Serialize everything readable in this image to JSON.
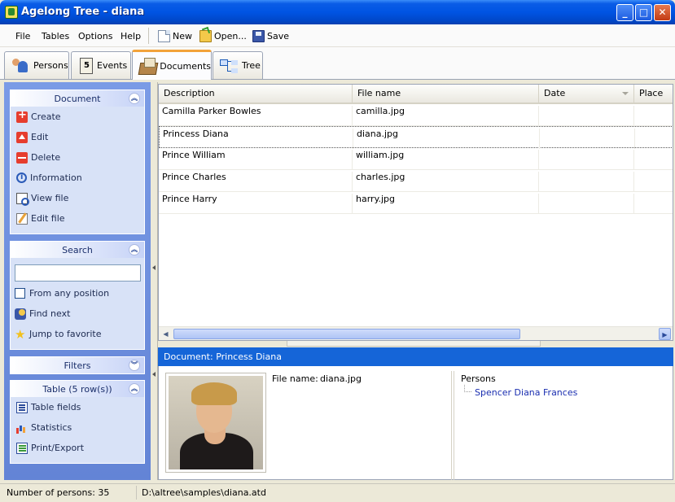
{
  "window": {
    "title": "Agelong Tree - diana"
  },
  "menu": [
    {
      "label": "File"
    },
    {
      "label": "Tables"
    },
    {
      "label": "Options"
    },
    {
      "label": "Help"
    }
  ],
  "toolbar": {
    "new_label": "New",
    "open_label": "Open...",
    "save_label": "Save"
  },
  "tabs": [
    {
      "label": "Persons",
      "icon": "persons-icon"
    },
    {
      "label": "Events",
      "icon": "calendar-icon"
    },
    {
      "label": "Documents",
      "icon": "documents-icon",
      "active": true
    },
    {
      "label": "Tree",
      "icon": "tree-icon"
    }
  ],
  "sidebar": {
    "document": {
      "title": "Document",
      "items": [
        {
          "label": "Create",
          "icon": "create-icon"
        },
        {
          "label": "Edit",
          "icon": "edit-icon"
        },
        {
          "label": "Delete",
          "icon": "delete-icon"
        },
        {
          "label": "Information",
          "icon": "information-icon"
        },
        {
          "label": "View file",
          "icon": "view-file-icon"
        },
        {
          "label": "Edit file",
          "icon": "edit-file-icon"
        }
      ]
    },
    "search": {
      "title": "Search",
      "input_value": "",
      "from_any_position": "From any position",
      "items": [
        {
          "label": "Find next",
          "icon": "find-next-icon"
        },
        {
          "label": "Jump to favorite",
          "icon": "star-icon"
        }
      ]
    },
    "filters": {
      "title": "Filters"
    },
    "table": {
      "title": "Table (5 row(s))",
      "items": [
        {
          "label": "Table fields",
          "icon": "table-fields-icon"
        },
        {
          "label": "Statistics",
          "icon": "statistics-icon"
        },
        {
          "label": "Print/Export",
          "icon": "print-export-icon"
        }
      ]
    }
  },
  "grid": {
    "columns": [
      "Description",
      "File name",
      "Date",
      "Place"
    ],
    "rows": [
      {
        "description": "Camilla Parker Bowles",
        "file": "camilla.jpg",
        "date": "",
        "place": ""
      },
      {
        "description": "Princess Diana",
        "file": "diana.jpg",
        "date": "",
        "place": "",
        "selected": true
      },
      {
        "description": "Prince William",
        "file": "william.jpg",
        "date": "",
        "place": ""
      },
      {
        "description": "Prince Charles",
        "file": "charles.jpg",
        "date": "",
        "place": ""
      },
      {
        "description": "Prince Harry",
        "file": "harry.jpg",
        "date": "",
        "place": ""
      }
    ]
  },
  "detail": {
    "header": "Document: Princess Diana",
    "file_label": "File name:",
    "file_value": "diana.jpg",
    "persons_label": "Persons",
    "persons": [
      "Spencer Diana Frances"
    ]
  },
  "status": {
    "persons_count": "Number of persons: 35",
    "path": "D:\\altree\\samples\\diana.atd"
  },
  "colors": {
    "title_bar": "#0054e3",
    "task_pane": "#6d8ee0",
    "detail_header": "#1565d8",
    "link": "#1a2eb0"
  }
}
